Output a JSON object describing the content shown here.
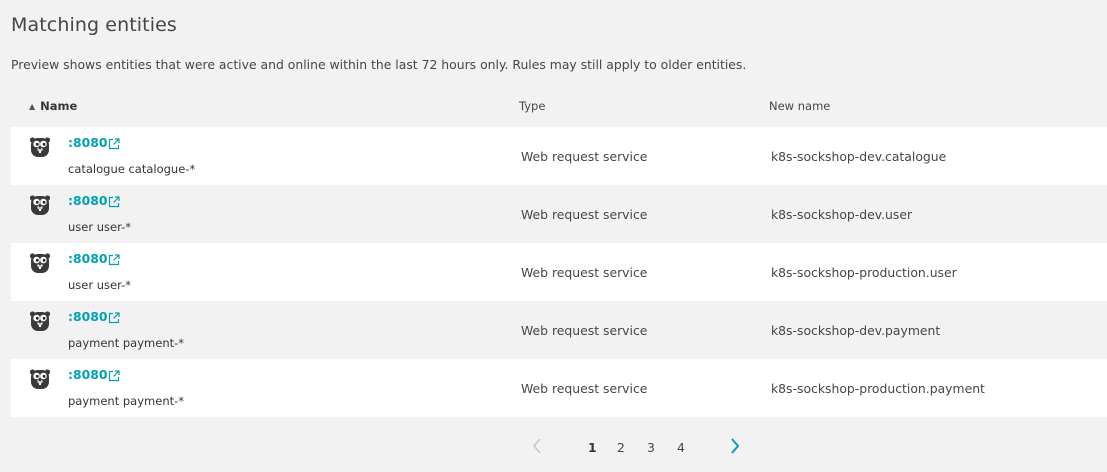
{
  "section": {
    "title": "Matching entities",
    "description": "Preview shows entities that were active and online within the last 72 hours only. Rules may still apply to older entities."
  },
  "table": {
    "columns": {
      "name": "Name",
      "type": "Type",
      "new_name": "New name"
    },
    "sort": {
      "column": "name",
      "direction": "ascending",
      "icon": "sort-up-icon"
    },
    "rows": [
      {
        "link": ":8080",
        "sub": "catalogue catalogue-*",
        "type": "Web request service",
        "new_name": "k8s-sockshop-dev.catalogue",
        "icon": "go-gopher-icon"
      },
      {
        "link": ":8080",
        "sub": "user user-*",
        "type": "Web request service",
        "new_name": "k8s-sockshop-dev.user",
        "icon": "go-gopher-icon"
      },
      {
        "link": ":8080",
        "sub": "user user-*",
        "type": "Web request service",
        "new_name": "k8s-sockshop-production.user",
        "icon": "go-gopher-icon"
      },
      {
        "link": ":8080",
        "sub": "payment payment-*",
        "type": "Web request service",
        "new_name": "k8s-sockshop-dev.payment",
        "icon": "go-gopher-icon"
      },
      {
        "link": ":8080",
        "sub": "payment payment-*",
        "type": "Web request service",
        "new_name": "k8s-sockshop-production.payment",
        "icon": "go-gopher-icon"
      }
    ]
  },
  "pagination": {
    "pages": [
      "1",
      "2",
      "3",
      "4"
    ],
    "current": "1",
    "prev_icon": "chevron-left-icon",
    "next_icon": "chevron-right-icon"
  },
  "colors": {
    "link": "#00a1b2",
    "background": "#f2f2f2",
    "row_alt": "#ffffff"
  }
}
